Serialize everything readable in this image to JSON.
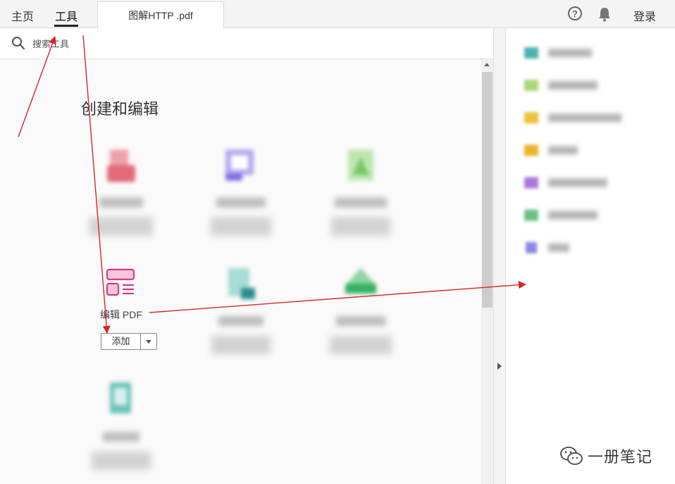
{
  "nav": {
    "home": "主页",
    "tools": "工具",
    "document_tab": "图解HTTP .pdf",
    "help_glyph": "?",
    "login": "登录"
  },
  "search": {
    "placeholder": "搜索工具"
  },
  "section": {
    "title": "创建和编辑"
  },
  "tools": [
    {
      "icon": "pink-blurred-icon",
      "color": "#e8707a",
      "label": "",
      "blurred": true
    },
    {
      "icon": "purple-blurred-icon",
      "color": "#8a7be0",
      "label": "",
      "blurred": true
    },
    {
      "icon": "green-blurred-icon",
      "color": "#8ccf7a",
      "label": "",
      "blurred": true
    },
    {
      "icon": "edit-pdf-icon",
      "color": "#d23a8c",
      "label": "编辑 PDF",
      "button": "添加",
      "blurred": false
    },
    {
      "icon": "teal-blurred-icon",
      "color": "#3aa7a0",
      "label": "",
      "blurred": true
    },
    {
      "icon": "green-blurred-icon",
      "color": "#3fb36a",
      "label": "",
      "blurred": true
    },
    {
      "icon": "teal-blurred-icon",
      "color": "#4bb3a6",
      "label": "",
      "blurred": true
    }
  ],
  "right_panel": [
    {
      "icon": "teal-blurred-icon",
      "color": "#4ab3b0"
    },
    {
      "icon": "green-blurred-icon",
      "color": "#9ccf6a"
    },
    {
      "icon": "yellow-blurred-icon",
      "color": "#e8c23a"
    },
    {
      "icon": "yellow-blurred-icon",
      "color": "#e8b830"
    },
    {
      "icon": "purple-blurred-icon",
      "color": "#a978d8"
    },
    {
      "icon": "green-blurred-icon",
      "color": "#6cc08a"
    },
    {
      "icon": "blue-blurred-icon",
      "color": "#8a8ae0"
    }
  ],
  "watermark": {
    "text": "一册笔记"
  },
  "colors": {
    "annotation": "#d42a2a",
    "edit_pdf_accent": "#d23a8c"
  }
}
